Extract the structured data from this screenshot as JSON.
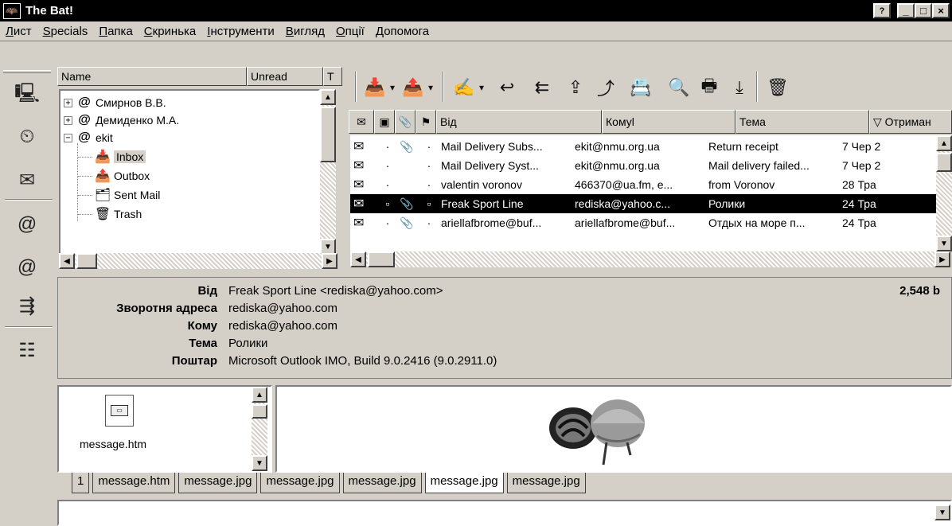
{
  "window": {
    "title": "The Bat!",
    "app_icon": "bat-icon",
    "controls": [
      "help-icon",
      "minimize-icon",
      "maximize-icon",
      "close-icon"
    ]
  },
  "menu": [
    "Лист",
    "Specials",
    "Папка",
    "Скринька",
    "Інструменти",
    "Вигляд",
    "Опції",
    "Допомога"
  ],
  "folder_pane": {
    "columns": [
      "Name",
      "Unread",
      "T"
    ],
    "tree": [
      {
        "label": "Смирнов В.В.",
        "expander": "+",
        "icon": "account-icon"
      },
      {
        "label": "Демиденко М.А.",
        "expander": "+",
        "icon": "account-icon"
      },
      {
        "label": "ekit",
        "expander": "−",
        "icon": "account-icon"
      },
      {
        "label": "Inbox",
        "icon": "inbox-icon"
      },
      {
        "label": "Outbox",
        "icon": "outbox-icon"
      },
      {
        "label": "Sent Mail",
        "icon": "sent-mail-icon"
      },
      {
        "label": "Trash",
        "icon": "trash-icon"
      }
    ]
  },
  "message_list": {
    "columns": [
      "Від",
      "Комуl",
      "Тема",
      "▽ Отриман"
    ],
    "rows": [
      {
        "from": "Mail Delivery Subs...",
        "to": "ekit@nmu.org.ua",
        "subject": "Return receipt",
        "received": "7 Чер 2"
      },
      {
        "from": "Mail Delivery Syst...",
        "to": "ekit@nmu.org.ua",
        "subject": "Mail delivery failed...",
        "received": "7 Чер 2"
      },
      {
        "from": "valentin voronov",
        "to": "466370@ua.fm, e...",
        "subject": "from Voronov",
        "received": "28 Тра"
      },
      {
        "from": "Freak Sport Line",
        "to": "rediska@yahoo.c...",
        "subject": "Ролики",
        "received": "24 Тра"
      },
      {
        "from": "ariellafbrome@buf...",
        "to": "ariellafbrome@buf...",
        "subject": "Отдых на море п...",
        "received": "24 Тра"
      }
    ]
  },
  "message_header": {
    "from_label": "Від",
    "from": "Freak Sport Line <rediska@yahoo.com>",
    "reply_label": "Зворотня адреса",
    "reply": "rediska@yahoo.com",
    "to_label": "Кому",
    "to": "rediska@yahoo.com",
    "subject_label": "Тема",
    "subject": "Ролики",
    "mailer_label": "Поштар",
    "mailer": "Microsoft Outlook IMO, Build 9.0.2416 (9.0.2911.0)",
    "size": "2,548 b"
  },
  "attachment": {
    "name": "message.htm"
  },
  "tabs": [
    "1",
    "message.htm",
    "message.jpg",
    "message.jpg",
    "message.jpg",
    "message.jpg",
    "message.jpg"
  ]
}
